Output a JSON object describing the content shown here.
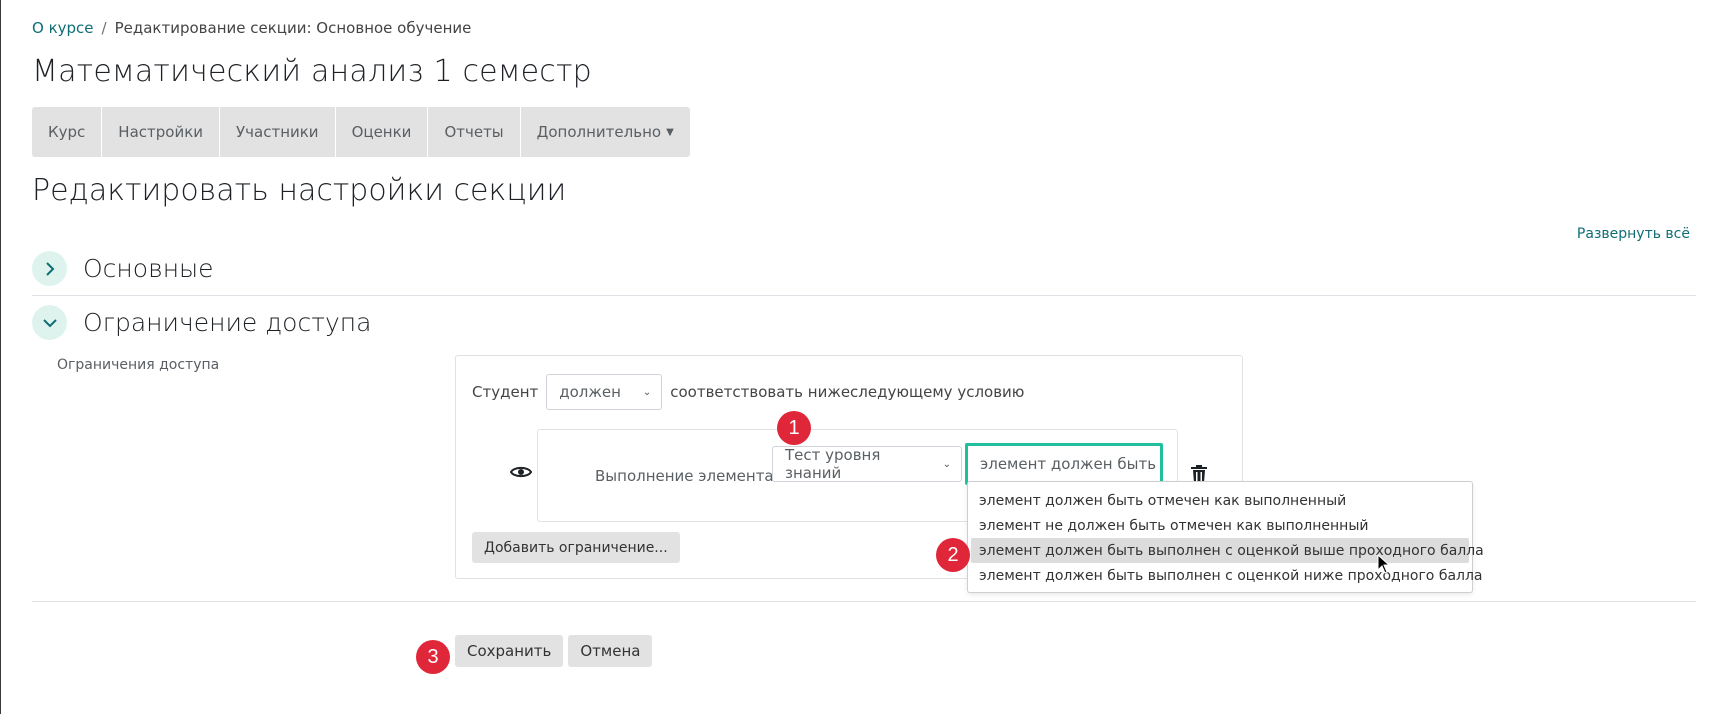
{
  "breadcrumb": {
    "course_link": "О курсе",
    "separator": "/",
    "current": "Редактирование секции: Основное обучение"
  },
  "course_title": "Математический анализ 1 семестр",
  "nav_tabs": {
    "course": "Курс",
    "settings": "Настройки",
    "participants": "Участники",
    "grades": "Оценки",
    "reports": "Отчеты",
    "more": "Дополнительно"
  },
  "page_heading": "Редактировать настройки секции",
  "expand_all": "Развернуть всё",
  "sections": {
    "general": "Основные",
    "restrict_access": "Ограничение доступа"
  },
  "restrictions": {
    "field_label": "Ограничения доступа",
    "student_label": "Студент",
    "must_select_value": "должен",
    "condition_suffix": "соответствовать нижеследующему условию",
    "condition_type_label": "Выполнение элемента",
    "activity_select_value": "Тест уровня знаний",
    "status_select_value": "элемент должен быть",
    "add_button": "Добавить ограничение...",
    "status_options": [
      "элемент должен быть отмечен как выполненный",
      "элемент не должен быть отмечен как выполненный",
      "элемент должен быть выполнен с оценкой выше проходного балла",
      "элемент должен быть выполнен с оценкой ниже проходного балла"
    ],
    "highlighted_option_index": 2
  },
  "buttons": {
    "save": "Сохранить",
    "cancel": "Отмена"
  },
  "badges": [
    "1",
    "2",
    "3"
  ],
  "colors": {
    "link": "#0f6e75",
    "accent_focus": "#1fbf9f",
    "badge": "#e0273a",
    "toggle_bg": "#dff3ee"
  }
}
